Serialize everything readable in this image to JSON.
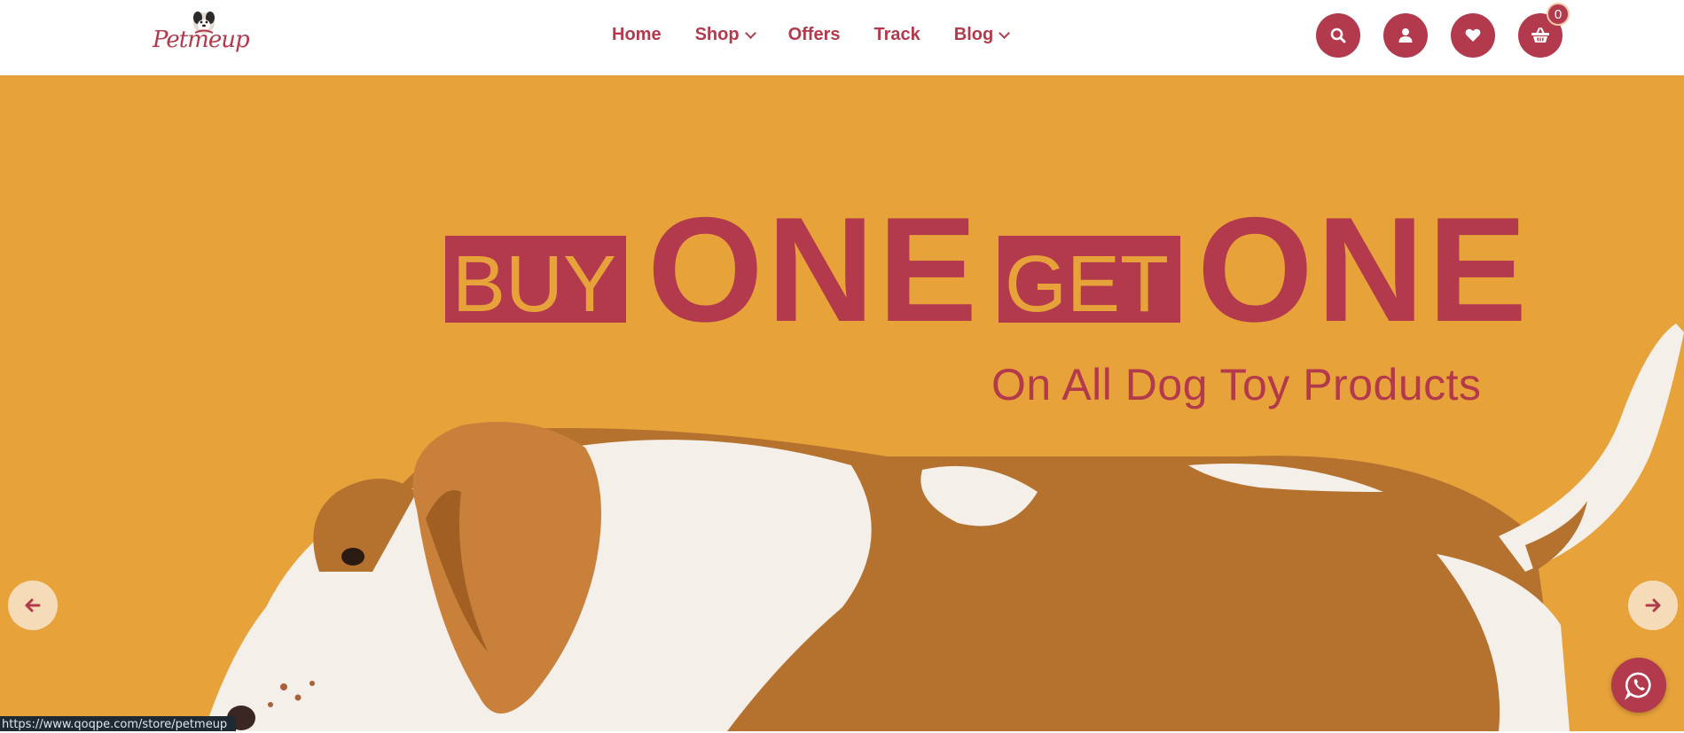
{
  "brand": {
    "logo_text": "Petmeup"
  },
  "nav": {
    "items": [
      {
        "label": "Home",
        "has_dropdown": false
      },
      {
        "label": "Shop",
        "has_dropdown": true
      },
      {
        "label": "Offers",
        "has_dropdown": false
      },
      {
        "label": "Track",
        "has_dropdown": false
      },
      {
        "label": "Blog",
        "has_dropdown": true
      }
    ]
  },
  "header_icons": [
    {
      "icon": "search-icon"
    },
    {
      "icon": "user-icon"
    },
    {
      "icon": "heart-icon"
    },
    {
      "icon": "basket-icon",
      "badge": "0"
    }
  ],
  "hero": {
    "buy": "BUY",
    "one_1": "ONE",
    "get": "GET",
    "one_2": "ONE",
    "subtitle": "On All Dog Toy Products"
  },
  "carousel": {
    "prev_icon": "arrow-left-icon",
    "next_icon": "arrow-right-icon"
  },
  "chat": {
    "icon": "whatsapp-icon"
  },
  "status_bar": {
    "url": "https://www.qoqpe.com/store/petmeup"
  },
  "colors": {
    "brand": "#b23a4c",
    "hero_bg": "#e8a23a",
    "arrow_bg": "#f6dbb8"
  }
}
